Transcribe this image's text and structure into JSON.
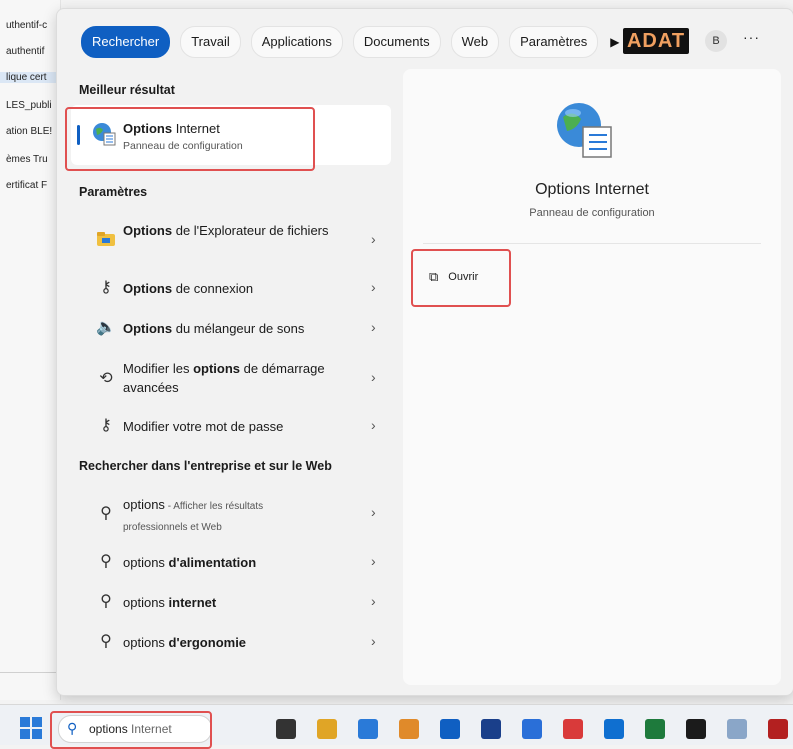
{
  "background_list": [
    "uthentif-c",
    "authentif",
    "lique cert",
    "LES_publi",
    "ation BLE!",
    "èmes Tru",
    "ertificat F"
  ],
  "tabs": [
    "Rechercher",
    "Travail",
    "Applications",
    "Documents",
    "Web",
    "Paramètres"
  ],
  "active_tab": "Rechercher",
  "logo_text": "ADAT",
  "avatar_initial": "B",
  "more_label": "···",
  "best_match": {
    "heading": "Meilleur résultat",
    "title_bold": "Options",
    "title_rest": " Internet",
    "subtitle": "Panneau de configuration"
  },
  "settings": {
    "heading": "Paramètres",
    "items": [
      {
        "pre": "",
        "bold": "Options",
        "post": " de l'Explorateur de fichiers",
        "icon": "folder-options-icon"
      },
      {
        "pre": "",
        "bold": "Options",
        "post": " de connexion",
        "icon": "key-icon"
      },
      {
        "pre": "",
        "bold": "Options",
        "post": " du mélangeur de sons",
        "icon": "speaker-icon"
      },
      {
        "pre": "Modifier les ",
        "bold": "options",
        "post": " de démarrage avancées",
        "icon": "recovery-icon"
      },
      {
        "pre": "Modifier votre mot de passe",
        "bold": "",
        "post": "",
        "icon": "key-icon"
      }
    ]
  },
  "web": {
    "heading": "Rechercher dans l'entreprise et sur le Web",
    "items": [
      {
        "pre": "options",
        "bold": "",
        "post": "",
        "note": " - Afficher les résultats professionnels et Web"
      },
      {
        "pre": "options ",
        "bold": "d'alimentation",
        "post": "",
        "note": ""
      },
      {
        "pre": "options ",
        "bold": "internet",
        "post": "",
        "note": ""
      },
      {
        "pre": "options ",
        "bold": "d'ergonomie",
        "post": "",
        "note": ""
      }
    ]
  },
  "preview": {
    "title": "Options Internet",
    "subtitle": "Panneau de configuration",
    "action_label": "Ouvrir"
  },
  "taskbar": {
    "search_query": "options",
    "search_query_rest": " Internet",
    "icon_colors": [
      "#333333",
      "#e0a526",
      "#2a7ad8",
      "#e08a2a",
      "#0f5fc2",
      "#1a3f8a",
      "#2a6fd8",
      "#d93a3a",
      "#0f6fd0",
      "#1e7a3c",
      "#1b1b1b",
      "#8aa6c8",
      "#b32020"
    ]
  },
  "colors": {
    "accent": "#0f5fc2",
    "highlight_box": "#e05050"
  }
}
